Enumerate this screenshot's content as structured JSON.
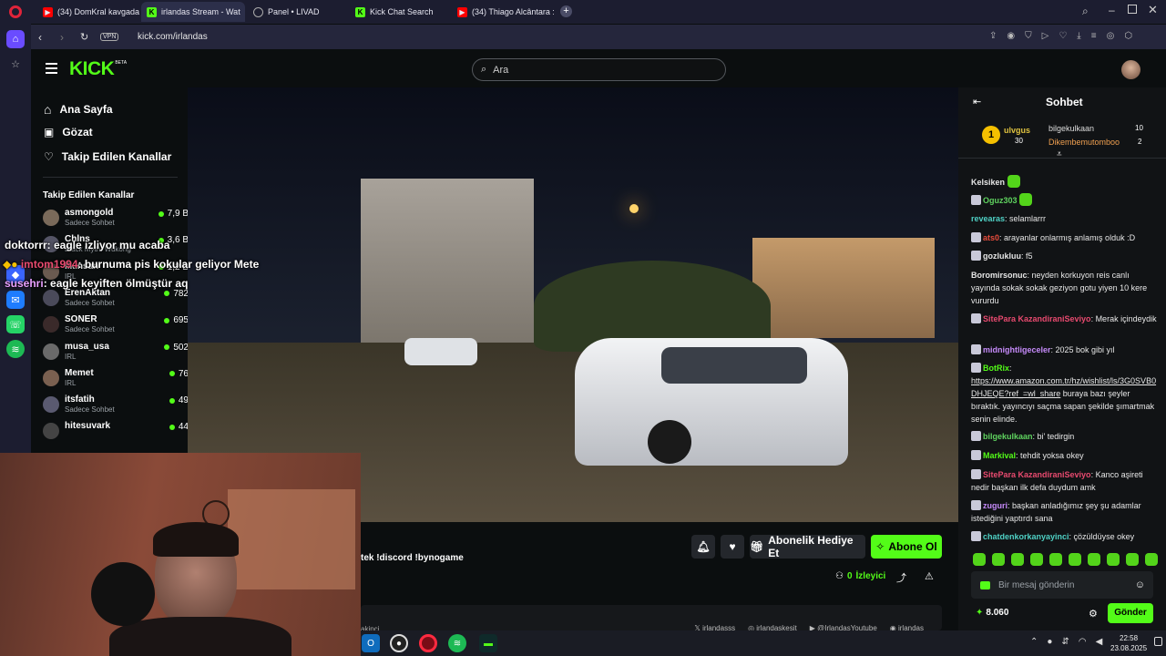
{
  "browser": {
    "tabs": [
      {
        "label": "(34) DomKral kavgadan s",
        "icon": "youtube-icon",
        "color": "#ff0000"
      },
      {
        "label": "irlandas Stream - Wat",
        "icon": "kick-icon",
        "color": "#53fc18"
      },
      {
        "label": "Panel • LIVAD",
        "icon": "globe-icon",
        "color": "#888888"
      },
      {
        "label": "Kick Chat Search",
        "icon": "kick-icon",
        "color": "#53fc18"
      },
      {
        "label": "(34) Thiago Alcântara :Virt",
        "icon": "youtube-icon",
        "color": "#ff0000"
      }
    ],
    "vpn": "VPN",
    "url": "kick.com/irlandas"
  },
  "kick": {
    "logo": "KICK",
    "logo_beta": "BETA",
    "search_placeholder": "Ara",
    "nav": {
      "home": "Ana Sayfa",
      "browse": "Gözat",
      "following": "Takip Edilen Kanallar"
    },
    "following_title": "Takip Edilen Kanallar",
    "following": [
      {
        "name": "asmongold",
        "category": "Sadece Sohbet",
        "viewers": "7,9 B",
        "avatar": "#7a6a5a"
      },
      {
        "name": "Chlns",
        "category": "Black Myth: Wukong",
        "viewers": "3,6 B",
        "avatar": "#555566"
      },
      {
        "name": "ilkinsan",
        "category": "IRL",
        "viewers": "1,2 B",
        "avatar": "#6a5a50"
      },
      {
        "name": "ErenAktan",
        "category": "Sadece Sohbet",
        "viewers": "782",
        "avatar": "#4a4a5a"
      },
      {
        "name": "SONER",
        "category": "Sadece Sohbet",
        "viewers": "695",
        "avatar": "#3a2a2a"
      },
      {
        "name": "musa_usa",
        "category": "IRL",
        "viewers": "502",
        "avatar": "#6a6a6a"
      },
      {
        "name": "Memet",
        "category": "IRL",
        "viewers": "76",
        "avatar": "#7a6050"
      },
      {
        "name": "itsfatih",
        "category": "Sadece Sohbet",
        "viewers": "49",
        "avatar": "#5a5a70"
      },
      {
        "name": "hitesuvark",
        "category": "",
        "viewers": "44",
        "avatar": "#444444"
      }
    ],
    "stream_title_fragment": "tek !discord !bynogame",
    "buttons": {
      "gift": "Abonelik Hediye Et",
      "subscribe": "Abone Ol"
    },
    "viewers_count": "0",
    "viewers_label": "İzleyici",
    "socials": [
      "irlandasss",
      "irlandaskesit",
      "@IrlandasYoutube",
      "irlandas"
    ],
    "below_fragment": "akipci"
  },
  "overlay": [
    {
      "user": "doktorrr",
      "text": ": eagle izliyor mu acaba"
    },
    {
      "user": "imtom1994",
      "text": ": burnuma pis kokular geliyor Mete"
    },
    {
      "user": "susehri",
      "text": ": eagle keyiften ölmüştür aq"
    }
  ],
  "chat": {
    "title": "Sohbet",
    "leaderboard": {
      "rank": "1",
      "first": "ulvgus",
      "first_count": "30",
      "second": "bilgekulkaan",
      "second_count": "10",
      "third": "Dikembemutomboo",
      "third_count": "2"
    },
    "messages": [
      {
        "user": "Kelsiken",
        "text": "",
        "color": "#e6e6e6",
        "emote": true
      },
      {
        "user": "Oguz303",
        "text": "",
        "color": "#5fd35f",
        "emote": true
      },
      {
        "user": "revearas",
        "text": ": selamlarrr",
        "color": "#4fd1c5"
      },
      {
        "user": "ats0",
        "text": ": arayanlar onlarmış anlamış olduk :D",
        "color": "#e74c3c"
      },
      {
        "user": "gozlukluu",
        "text": ": f5",
        "color": "#e6e6e6"
      },
      {
        "user": "Boromirsonuc",
        "text": ": neyden korkuyon reis canlı yayında sokak sokak geziyon gotu yiyen 10 kere vururdu",
        "color": "#e6e6e6"
      },
      {
        "user": "SitePara KazandiraniSeviyo",
        "text": ": Merak içindeydik",
        "color": "#e84a6f"
      },
      {
        "user": "midnightligeceler",
        "text": ": 2025 bok gibi yıl",
        "color": "#c58af9"
      },
      {
        "user": "BotRix",
        "text": ":",
        "color": "#53fc18",
        "link": "https://www.amazon.com.tr/hz/wishlist/ls/3G0SVB0DHJEQE?ref_=wl_share",
        "after": " buraya bazı şeyler bıraktık. yayıncıyı saçma sapan şekilde şımartmak senin elinde."
      },
      {
        "user": "bilgekulkaan",
        "text": ": bi' tedirgin",
        "color": "#5fd35f"
      },
      {
        "user": "Markival",
        "text": ": tehdit yoksa okey",
        "color": "#53fc18"
      },
      {
        "user": "SitePara KazandiraniSeviyo",
        "text": ": Kanco aşireti nedir başkan ilk defa duydum amk",
        "color": "#e84a6f"
      },
      {
        "user": "zuguri",
        "text": ": başkan anladığımız şey şu adamlar istediğini yaptırdı sana",
        "color": "#c58af9"
      },
      {
        "user": "chatdenkorkanyayinci",
        "text": ": çözüldüyse okey",
        "color": "#4fd1c5"
      }
    ],
    "input_placeholder": "Bir mesaj gönderin",
    "points": "8.060",
    "send": "Gönder"
  },
  "taskbar": {
    "time": "22:58",
    "date": "23.08.2025"
  }
}
